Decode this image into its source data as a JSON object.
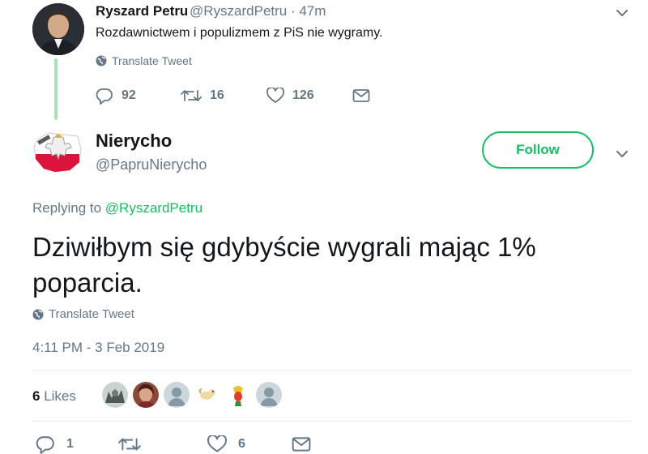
{
  "parent_tweet": {
    "name": "Ryszard Petru",
    "handle": "@RyszardPetru · 47m",
    "text": "Rozdawnictwem i populizmem z PiS nie wygramy.",
    "translate": "Translate Tweet",
    "replies": "92",
    "retweets": "16",
    "likes": "126"
  },
  "tweet": {
    "name": "Nierycho",
    "handle": "@PapruNierycho",
    "follow_label": "Follow",
    "replying_prefix": "Replying to",
    "replying_to": "@RyszardPetru",
    "text": "Dziwiłbym się gdybyście wygrali mając 1% poparcia.",
    "translate": "Translate Tweet",
    "timestamp": "4:11 PM - 3 Feb 2019",
    "likes_count": "6",
    "likes_label": "Likes",
    "replies": "1",
    "retweets": "",
    "likes": "6"
  },
  "colors": {
    "accent": "#17bf63",
    "muted": "#657786",
    "divider": "#e6ecf0"
  },
  "icons": [
    "chevron-down-icon",
    "globe-icon",
    "reply-icon",
    "retweet-icon",
    "heart-icon",
    "mail-icon"
  ]
}
